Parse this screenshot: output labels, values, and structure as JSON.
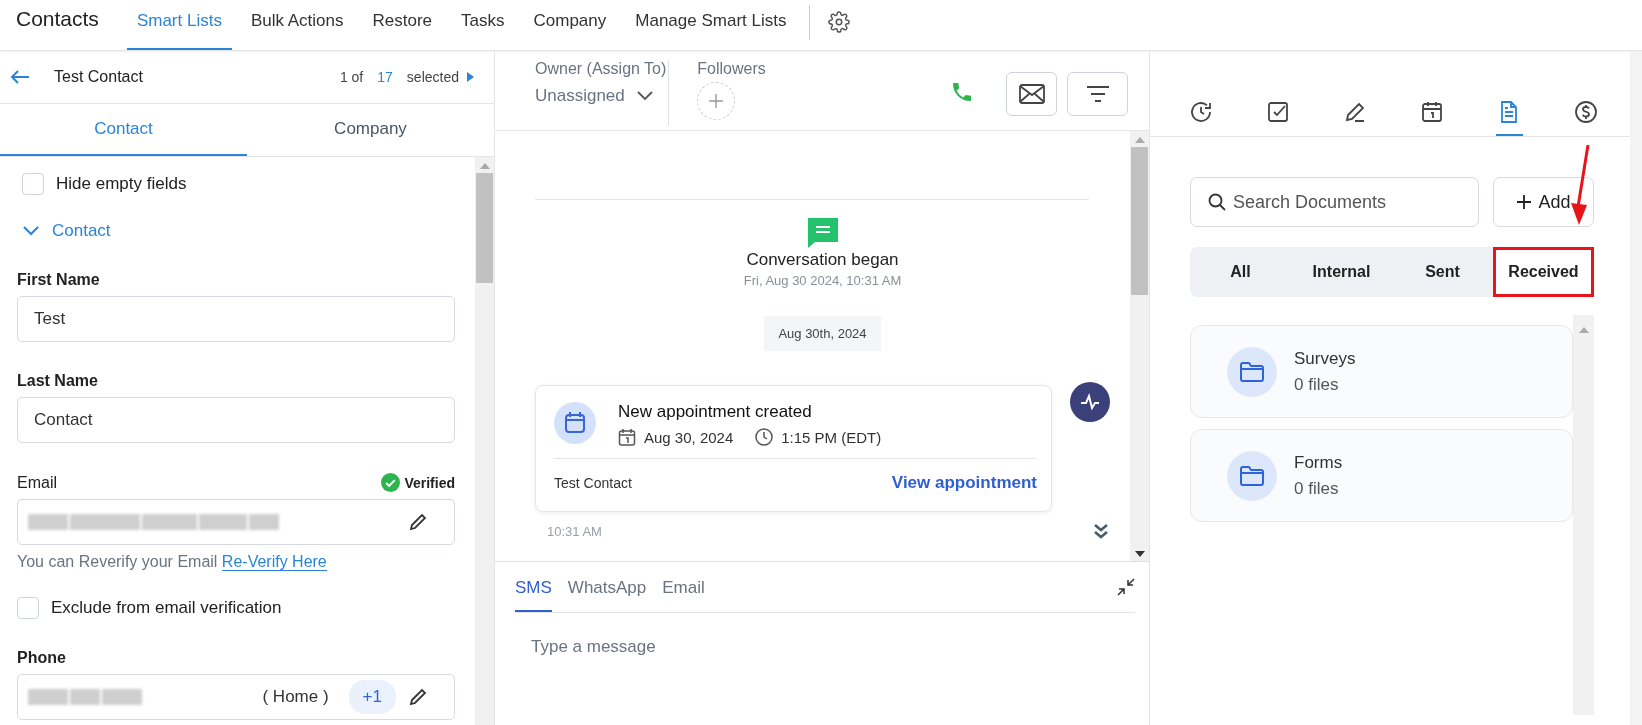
{
  "nav": {
    "title": "Contacts",
    "items": [
      {
        "label": "Smart Lists",
        "selected": true
      },
      {
        "label": "Bulk Actions",
        "selected": false
      },
      {
        "label": "Restore",
        "selected": false
      },
      {
        "label": "Tasks",
        "selected": false
      },
      {
        "label": "Company",
        "selected": false
      },
      {
        "label": "Manage Smart Lists",
        "selected": false
      }
    ]
  },
  "contact_header": {
    "name": "Test Contact",
    "position": "1 of",
    "count": "17",
    "suffix": "selected"
  },
  "left_tabs": [
    {
      "label": "Contact",
      "selected": true
    },
    {
      "label": "Company",
      "selected": false
    }
  ],
  "hide_empty": {
    "label": "Hide empty fields",
    "checked": false
  },
  "section": {
    "label": "Contact",
    "expanded": true
  },
  "first_name": {
    "label": "First Name",
    "value": "Test"
  },
  "last_name": {
    "label": "Last Name",
    "value": "Contact"
  },
  "email": {
    "label": "Email",
    "status": "Verified",
    "hint": "You can Reverify your Email",
    "link": "Re-Verify Here"
  },
  "exclude": {
    "label": "Exclude from email verification",
    "checked": false
  },
  "phone": {
    "label": "Phone",
    "type": "( Home )",
    "code": "+1"
  },
  "owner": {
    "label": "Owner (Assign To)",
    "value": "Unassigned"
  },
  "followers": {
    "label": "Followers"
  },
  "conversation": {
    "title": "Conversation began",
    "time": "Fri, Aug 30 2024, 10:31 AM"
  },
  "date_chip": "Aug 30th, 2024",
  "appointment": {
    "title": "New appointment created",
    "date": "Aug 30, 2024",
    "time": "1:15 PM (EDT)",
    "contact": "Test Contact",
    "link": "View appointment",
    "timestamp": "10:31 AM"
  },
  "composer": {
    "channels": [
      {
        "label": "SMS",
        "selected": true
      },
      {
        "label": "WhatsApp",
        "selected": false
      },
      {
        "label": "Email",
        "selected": false
      }
    ],
    "placeholder": "Type a message"
  },
  "panel_tabs": [
    {
      "kind": "history",
      "selected": false
    },
    {
      "kind": "task",
      "selected": false
    },
    {
      "kind": "note",
      "selected": false
    },
    {
      "kind": "calendar",
      "selected": false
    },
    {
      "kind": "document",
      "selected": true
    },
    {
      "kind": "payment",
      "selected": false
    }
  ],
  "search": {
    "placeholder": "Search Documents"
  },
  "add_button": "Add",
  "filters": [
    {
      "label": "All",
      "selected": false,
      "highlighted": false
    },
    {
      "label": "Internal",
      "selected": false,
      "highlighted": false
    },
    {
      "label": "Sent",
      "selected": false,
      "highlighted": false
    },
    {
      "label": "Received",
      "selected": true,
      "highlighted": true
    }
  ],
  "folders": [
    {
      "name": "Surveys",
      "count": "0 files"
    },
    {
      "name": "Forms",
      "count": "0 files"
    }
  ]
}
